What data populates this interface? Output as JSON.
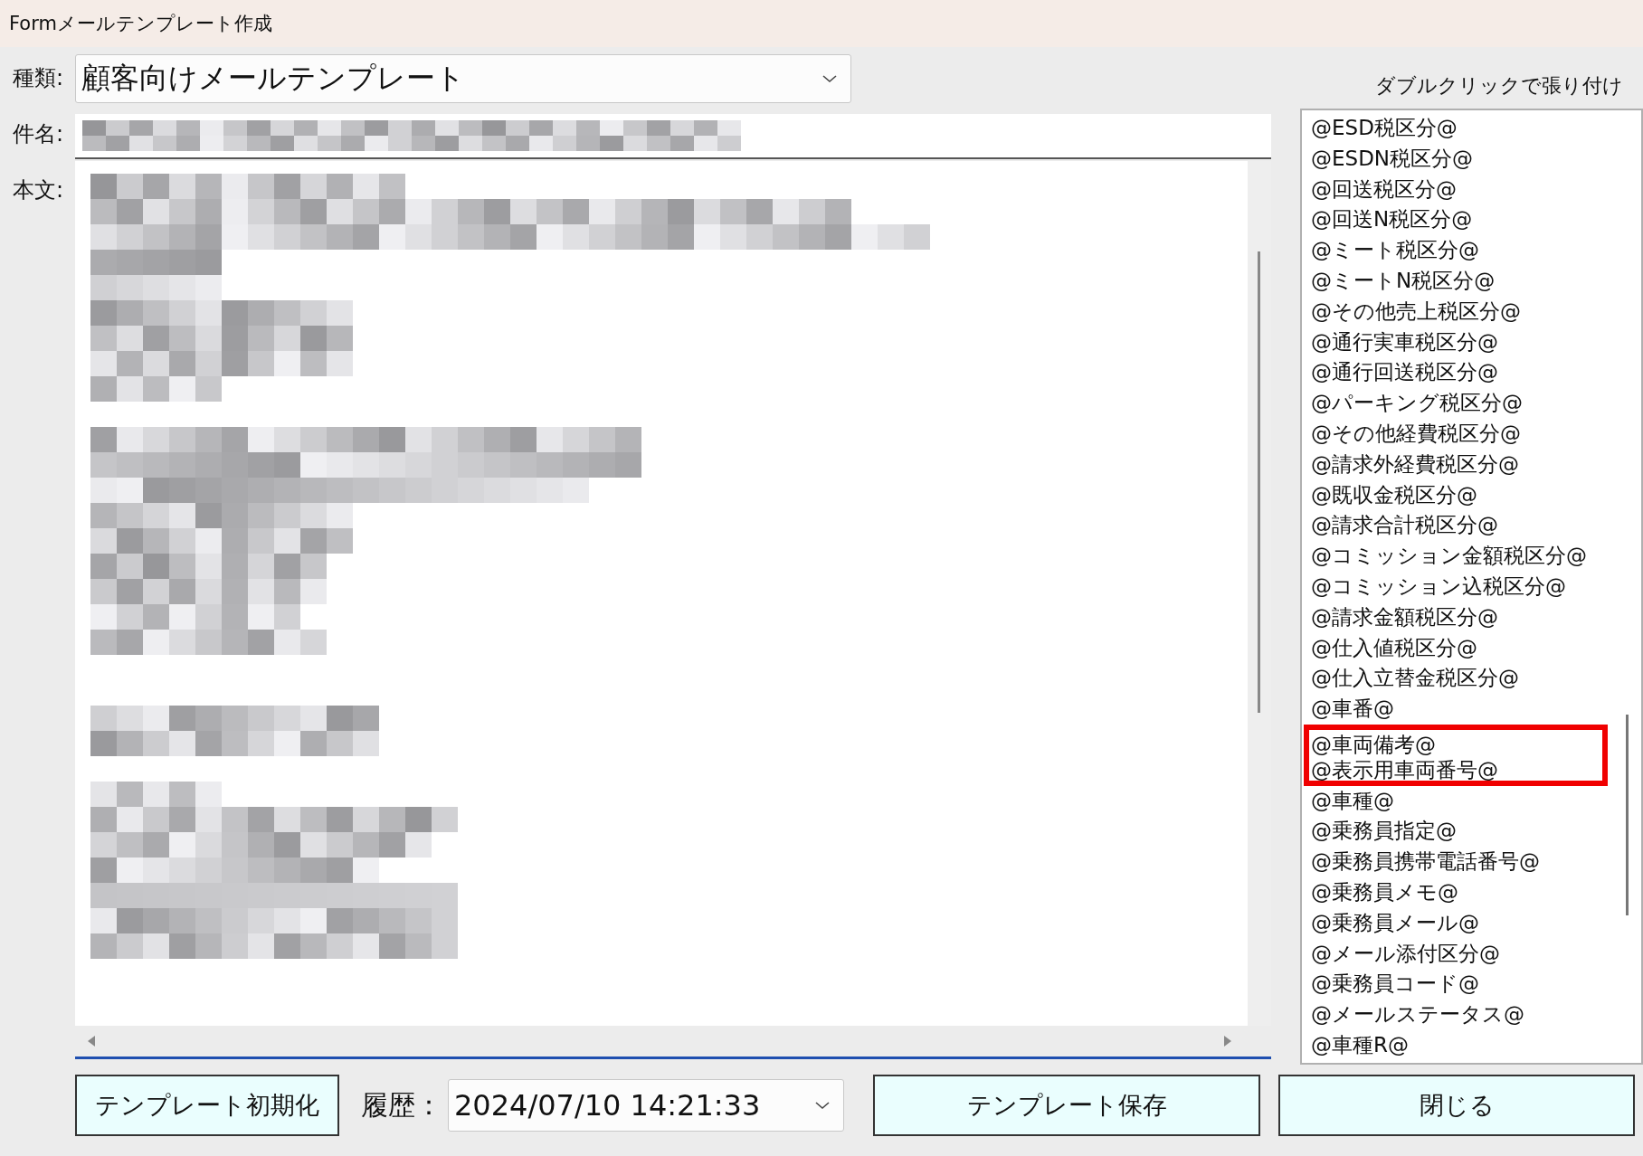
{
  "window": {
    "title": "Formメールテンプレート作成"
  },
  "type_field": {
    "label": "種類:",
    "value": "顧客向けメールテンプレート"
  },
  "subject_field": {
    "label": "件名:"
  },
  "body_field": {
    "label": "本文:"
  },
  "paste_list": {
    "header": "ダブルクリックで張り付け",
    "items": [
      {
        "text": "@ESD税区分@",
        "highlighted": false
      },
      {
        "text": "@ESDN税区分@",
        "highlighted": false
      },
      {
        "text": "@回送税区分@",
        "highlighted": false
      },
      {
        "text": "@回送N税区分@",
        "highlighted": false
      },
      {
        "text": "@ミート税区分@",
        "highlighted": false
      },
      {
        "text": "@ミートN税区分@",
        "highlighted": false
      },
      {
        "text": "@その他売上税区分@",
        "highlighted": false
      },
      {
        "text": "@通行実車税区分@",
        "highlighted": false
      },
      {
        "text": "@通行回送税区分@",
        "highlighted": false
      },
      {
        "text": "@パーキング税区分@",
        "highlighted": false
      },
      {
        "text": "@その他経費税区分@",
        "highlighted": false
      },
      {
        "text": "@請求外経費税区分@",
        "highlighted": false
      },
      {
        "text": "@既収金税区分@",
        "highlighted": false
      },
      {
        "text": "@請求合計税区分@",
        "highlighted": false
      },
      {
        "text": "@コミッション金額税区分@",
        "highlighted": false
      },
      {
        "text": "@コミッション込税区分@",
        "highlighted": false
      },
      {
        "text": "@請求金額税区分@",
        "highlighted": false
      },
      {
        "text": "@仕入値税区分@",
        "highlighted": false
      },
      {
        "text": "@仕入立替金税区分@",
        "highlighted": false
      },
      {
        "text": "@車番@",
        "highlighted": false
      },
      {
        "text": "@車両備考@",
        "highlighted": true
      },
      {
        "text": "@表示用車両番号@",
        "highlighted": true
      },
      {
        "text": "@車種@",
        "highlighted": false
      },
      {
        "text": "@乗務員指定@",
        "highlighted": false
      },
      {
        "text": "@乗務員携帯電話番号@",
        "highlighted": false
      },
      {
        "text": "@乗務員メモ@",
        "highlighted": false
      },
      {
        "text": "@乗務員メール@",
        "highlighted": false
      },
      {
        "text": "@メール添付区分@",
        "highlighted": false
      },
      {
        "text": "@乗務員コード@",
        "highlighted": false
      },
      {
        "text": "@メールステータス@",
        "highlighted": false
      },
      {
        "text": "@車種R@",
        "highlighted": false
      }
    ]
  },
  "buttons": {
    "reset": "テンプレート初期化",
    "save": "テンプレート保存",
    "close": "閉じる"
  },
  "history_field": {
    "label": "履歴：",
    "value": "2024/07/10 14:21:33"
  }
}
